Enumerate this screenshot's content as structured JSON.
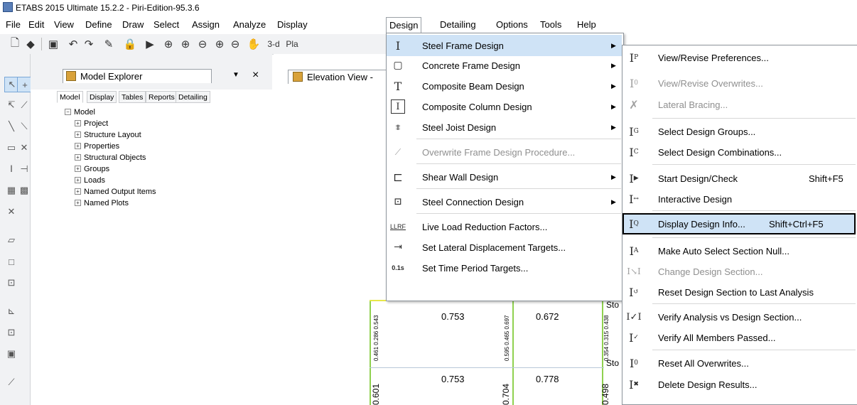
{
  "app": {
    "title": "ETABS 2015 Ultimate 15.2.2 - Piri-Edition-95.3.6"
  },
  "menubar": {
    "file": "File",
    "edit": "Edit",
    "view": "View",
    "define": "Define",
    "draw": "Draw",
    "select": "Select",
    "assign": "Assign",
    "analyze": "Analyze",
    "display": "Display",
    "design": "Design",
    "detailing": "Detailing",
    "options": "Options",
    "tools": "Tools",
    "help": "Help"
  },
  "toolbar": {
    "view_3d_label": "3-d",
    "plan_label": "Pla"
  },
  "explorer": {
    "title": "Model Explorer",
    "tabs": [
      "Model",
      "Display",
      "Tables",
      "Reports",
      "Detailing"
    ],
    "root": "Model",
    "items": [
      "Project",
      "Structure Layout",
      "Properties",
      "Structural Objects",
      "Groups",
      "Loads",
      "Named Output Items",
      "Named Plots"
    ]
  },
  "elevation": {
    "tab_title": "Elevation View -",
    "story_labels": [
      "Sto",
      "Sto"
    ],
    "ratios_row1": [
      "0.753",
      "0.672"
    ],
    "ratios_row2": [
      "0.753",
      "0.778"
    ],
    "col_small": [
      "0.461 0.286 0.543",
      "0.595 0.465 0.697",
      "0.354 0.315 0.438"
    ],
    "col_large": [
      "0.601",
      "0.704",
      "0.498"
    ]
  },
  "design_menu": {
    "items": [
      {
        "label": "Steel Frame Design",
        "icon": "steel-frame-icon",
        "submenu": true
      },
      {
        "label": "Concrete Frame Design",
        "icon": "concrete-frame-icon",
        "submenu": true
      },
      {
        "label": "Composite Beam Design",
        "icon": "composite-beam-icon",
        "submenu": true
      },
      {
        "label": "Composite Column Design",
        "icon": "composite-column-icon",
        "submenu": true
      },
      {
        "label": "Steel Joist Design",
        "icon": "steel-joist-icon",
        "submenu": true
      },
      {
        "label": "Overwrite Frame Design Procedure...",
        "icon": "overwrite-procedure-icon",
        "submenu": false,
        "disabled": true
      },
      {
        "label": "Shear Wall Design",
        "icon": "shear-wall-icon",
        "submenu": true
      },
      {
        "label": "Steel Connection Design",
        "icon": "steel-connection-icon",
        "submenu": true
      },
      {
        "label": "Live Load Reduction Factors...",
        "icon": "llrf-icon",
        "submenu": false
      },
      {
        "label": "Set Lateral Displacement Targets...",
        "icon": "lateral-displacement-icon",
        "submenu": false
      },
      {
        "label": "Set Time Period Targets...",
        "icon": "time-period-icon",
        "submenu": false
      }
    ],
    "llrf_icon_text": "LLRF",
    "time_icon_text": "0.1s"
  },
  "steel_submenu": {
    "items": [
      {
        "label": "View/Revise Preferences...",
        "shortcut": ""
      },
      {
        "label": "View/Revise Overwrites...",
        "shortcut": "",
        "disabled": true
      },
      {
        "label": "Lateral Bracing...",
        "shortcut": "",
        "disabled": true
      },
      {
        "label": "Select Design Groups...",
        "shortcut": ""
      },
      {
        "label": "Select Design Combinations...",
        "shortcut": ""
      },
      {
        "label": "Start Design/Check",
        "shortcut": "Shift+F5"
      },
      {
        "label": "Interactive Design",
        "shortcut": ""
      },
      {
        "label": "Display Design Info...",
        "shortcut": "Shift+Ctrl+F5"
      },
      {
        "label": "Make Auto Select Section Null...",
        "shortcut": ""
      },
      {
        "label": "Change Design Section...",
        "shortcut": "",
        "disabled": true
      },
      {
        "label": "Reset Design Section to Last Analysis",
        "shortcut": ""
      },
      {
        "label": "Verify Analysis vs Design Section...",
        "shortcut": ""
      },
      {
        "label": "Verify All Members Passed...",
        "shortcut": ""
      },
      {
        "label": "Reset All Overwrites...",
        "shortcut": ""
      },
      {
        "label": "Delete Design Results...",
        "shortcut": ""
      }
    ]
  },
  "colors": {
    "highlight": "#cfe3f6",
    "menu_border": "#8d949b",
    "disabled": "#8f8f8f",
    "frame_green": "#8fd14f",
    "frame_yellow": "#e8e84a"
  }
}
